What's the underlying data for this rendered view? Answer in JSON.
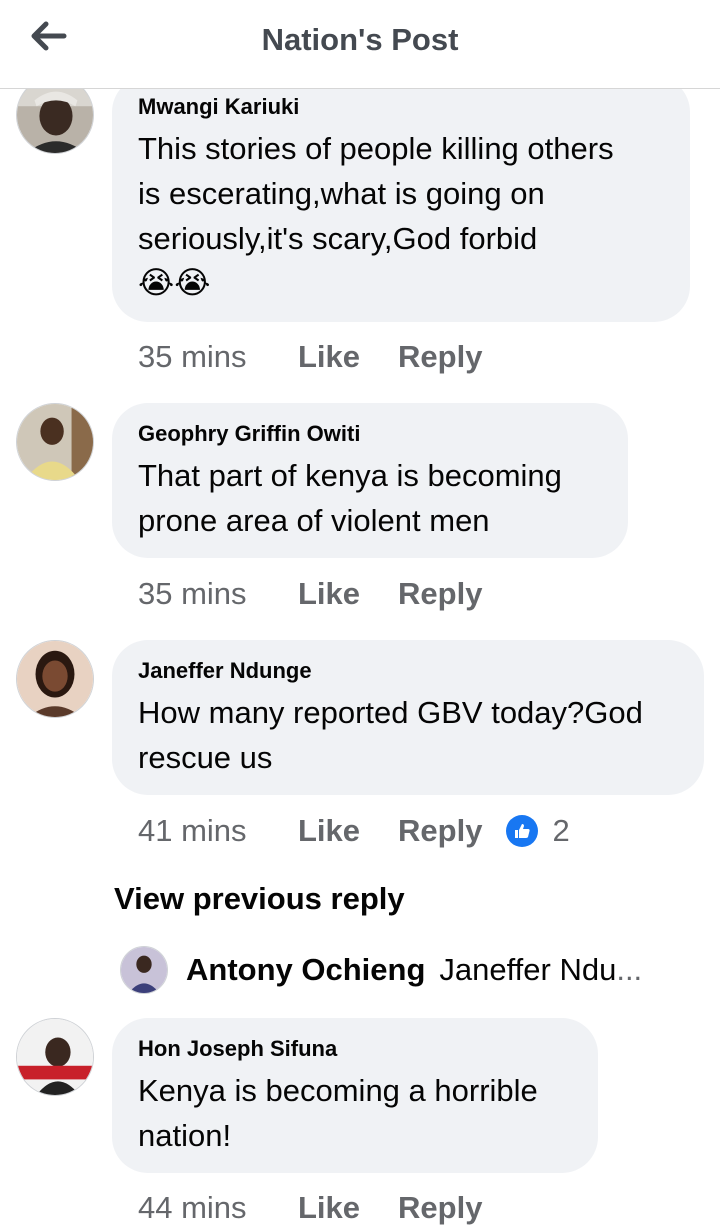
{
  "header": {
    "title": "Nation's Post",
    "back_icon": "arrow-left-icon"
  },
  "comments": [
    {
      "author": "Mwangi Kariuki",
      "lines": [
        "This stories of people killing others",
        "is escerating,what is going on",
        "seriously,it's scary,God forbid"
      ],
      "emoji": "😭😭",
      "time": "35 mins",
      "like": "Like",
      "reply": "Reply"
    },
    {
      "author": "Geophry Griffin Owiti",
      "lines": [
        "That part of kenya is becoming",
        "prone area of violent men"
      ],
      "time": "35 mins",
      "like": "Like",
      "reply": "Reply"
    },
    {
      "author": "Janeffer Ndunge",
      "lines": [
        "How many reported GBV today?God",
        "rescue us"
      ],
      "time": "41 mins",
      "like": "Like",
      "reply": "Reply",
      "reaction_icon": "thumbs-up-icon",
      "reaction_count": "2"
    },
    {
      "author": "Hon Joseph Sifuna",
      "lines": [
        "Kenya is becoming a horrible",
        "nation!"
      ],
      "time": "44 mins",
      "like": "Like",
      "reply": "Reply"
    }
  ],
  "view_previous": "View previous reply",
  "reply_preview": {
    "author": "Antony Ochieng",
    "snippet": "Janeffer Ndu",
    "ellipsis": "..."
  },
  "colors": {
    "bubble": "#f0f2f5",
    "meta": "#65676b",
    "like_blue": "#1877f2",
    "header_title": "#444950"
  }
}
